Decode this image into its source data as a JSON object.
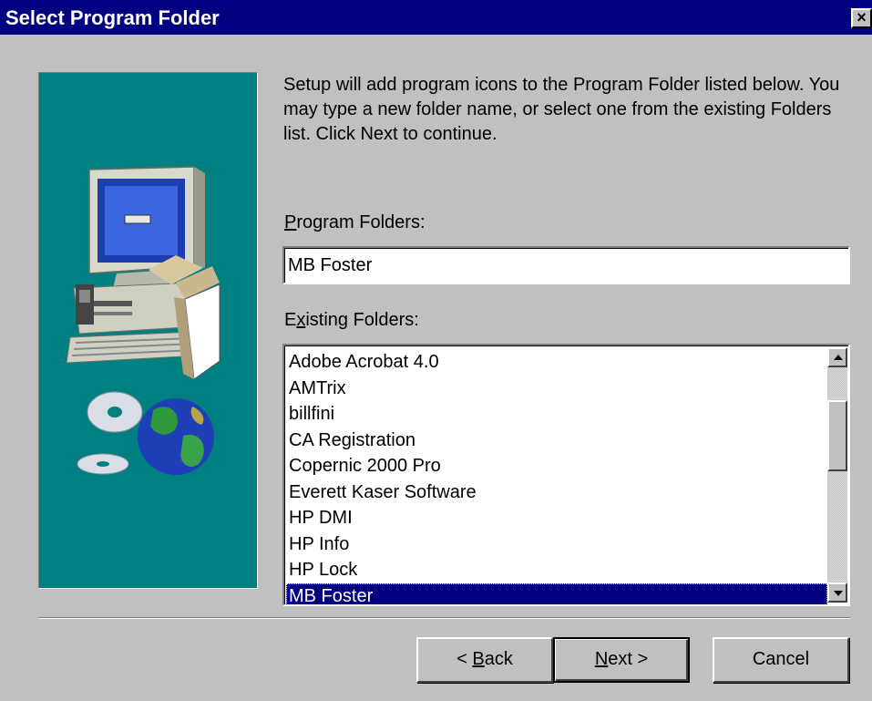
{
  "window": {
    "title": "Select Program Folder",
    "close_glyph": "×"
  },
  "description": "Setup will add program icons to the Program Folder listed below.  You may type a new folder name, or select one from the existing Folders list.  Click Next to continue.",
  "program_folders": {
    "label_mnemonic": "P",
    "label_rest": "rogram Folders:",
    "value": "MB Foster"
  },
  "existing_folders": {
    "label_first": "E",
    "label_mnemonic": "x",
    "label_rest": "isting Folders:",
    "items": [
      "Adobe Acrobat 4.0",
      "AMTrix",
      "billfini",
      "CA Registration",
      "Copernic 2000 Pro",
      "Everett Kaser Software",
      "HP DMI",
      "HP Info",
      "HP Lock",
      "MB Foster"
    ],
    "selected": "MB Foster"
  },
  "buttons": {
    "back_prefix": "< ",
    "back_mnemonic": "B",
    "back_rest": "ack",
    "next_mnemonic": "N",
    "next_rest": "ext >",
    "cancel": "Cancel"
  },
  "icons": {
    "art": "setup-computer-globe-illustration",
    "close": "close-icon",
    "scroll_up": "scroll-up-arrow-icon",
    "scroll_down": "scroll-down-arrow-icon"
  },
  "colors": {
    "titlebar": "#000080",
    "dialog": "#c0c0c0",
    "art_background": "#008080",
    "selection": "#000080"
  }
}
